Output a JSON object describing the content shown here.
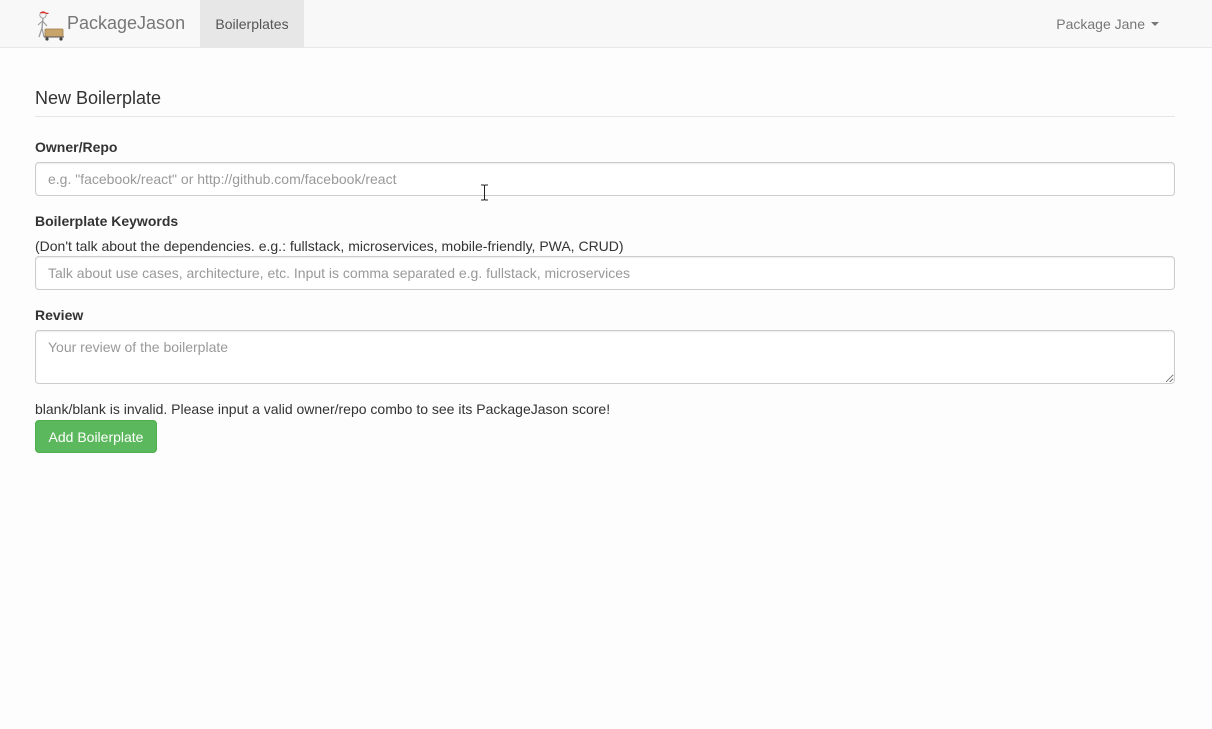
{
  "navbar": {
    "brand": "PackageJason",
    "tabs": [
      {
        "label": "Boilerplates",
        "active": true
      }
    ],
    "user_menu": "Package Jane",
    "user_menu_icon": "caret-down-icon"
  },
  "form": {
    "title": "New Boilerplate",
    "owner_repo": {
      "label": "Owner/Repo",
      "placeholder": "e.g. \"facebook/react\" or http://github.com/facebook/react",
      "value": ""
    },
    "keywords": {
      "label": "Boilerplate Keywords",
      "help": "(Don't talk about the dependencies. e.g.: fullstack, microservices, mobile-friendly, PWA, CRUD)",
      "placeholder": "Talk about use cases, architecture, etc. Input is comma separated e.g. fullstack, microservices",
      "value": ""
    },
    "review": {
      "label": "Review",
      "placeholder": "Your review of the boilerplate",
      "value": ""
    },
    "validation_message": "blank/blank is invalid. Please input a valid owner/repo combo to see its PackageJason score!",
    "submit_label": "Add Boilerplate"
  },
  "colors": {
    "navbar_bg": "#f8f8f8",
    "active_tab_bg": "#e7e7e7",
    "submit_bg": "#5cb85c",
    "text": "#333333"
  }
}
